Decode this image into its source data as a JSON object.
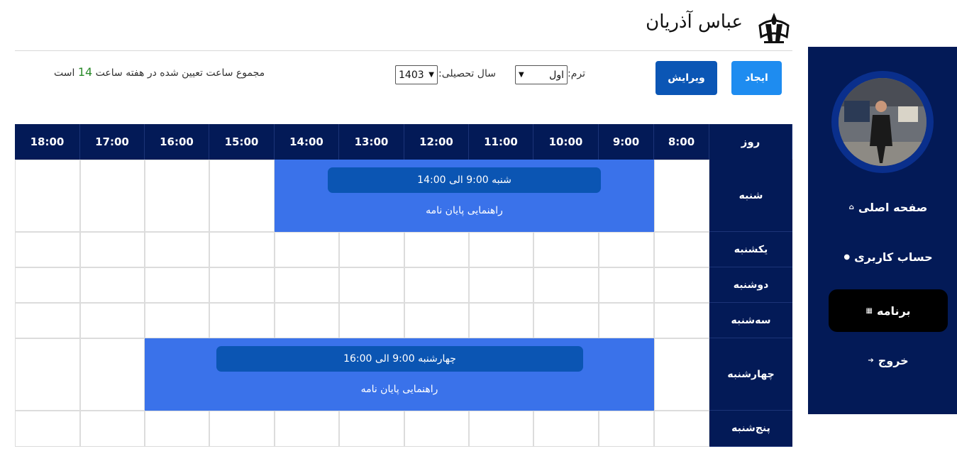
{
  "header": {
    "user_name": "عباس آذریان",
    "logo_icon": "university-emblem-icon"
  },
  "sidebar": {
    "items": [
      {
        "label": "صفحه اصلی",
        "icon": "home-icon",
        "glyph": "⌂"
      },
      {
        "label": "حساب کاربری",
        "icon": "user-icon",
        "glyph": "●"
      },
      {
        "label": "برنامه",
        "icon": "calendar-icon",
        "glyph": "▦",
        "active": true
      },
      {
        "label": "خروج",
        "icon": "logout-icon",
        "glyph": "➔"
      }
    ]
  },
  "toolbar": {
    "create_label": "ایجاد",
    "edit_label": "ویرایش",
    "term_label": "ترم:",
    "term_value": "اول",
    "year_label": "سال تحصیلی:",
    "year_value": "1403",
    "total_prefix": "مجموع ساعت تعیین شده در هفته ساعت",
    "total_value": "14",
    "total_suffix": "است"
  },
  "schedule": {
    "day_header": "روز",
    "hours": [
      "8:00",
      "9:00",
      "10:00",
      "11:00",
      "12:00",
      "13:00",
      "14:00",
      "15:00",
      "16:00",
      "17:00",
      "18:00"
    ],
    "days": [
      "شنبه",
      "یکشنبه",
      "دوشنبه",
      "سه‌شنبه",
      "چهارشنبه",
      "پنج‌شنبه"
    ],
    "events": [
      {
        "day": "شنبه",
        "time_text": "شنبه 9:00 الی 14:00",
        "title": "راهنمایی پایان نامه",
        "start": "9:00",
        "end": "14:00"
      },
      {
        "day": "چهارشنبه",
        "time_text": "چهارشنبه 9:00 الی 16:00",
        "title": "راهنمایی پایان نامه",
        "start": "9:00",
        "end": "16:00"
      }
    ]
  },
  "colors": {
    "navy": "#031a57",
    "event_bg": "#3a72ea",
    "event_pill": "#0b55b3",
    "create_btn": "#1e8cf0",
    "edit_btn": "#0b56b5",
    "total_number": "#2a8a2a"
  }
}
